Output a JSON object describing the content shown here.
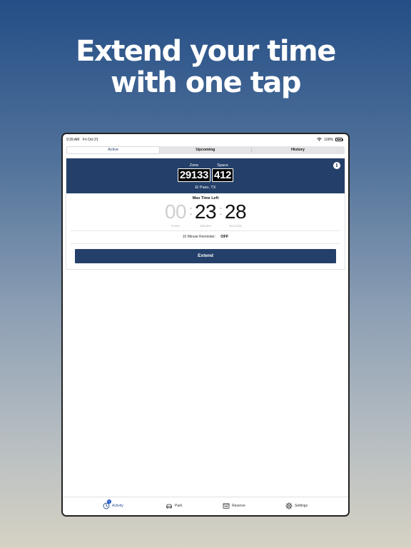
{
  "headline": {
    "line1": "Extend your time",
    "line2": "with one tap"
  },
  "status_bar": {
    "time": "9:39 AM",
    "date": "Fri Oct 21",
    "battery": "100%"
  },
  "segments": [
    {
      "label": "Active",
      "selected": true
    },
    {
      "label": "Upcoming",
      "selected": false
    },
    {
      "label": "History",
      "selected": false
    }
  ],
  "session": {
    "zone_label": "Zone",
    "zone": "29133",
    "space_label": "Space",
    "space": "412",
    "location": "El Paso, TX",
    "info_icon": "i"
  },
  "timer": {
    "title": "Max Time Left",
    "hours": "00",
    "minutes": "23",
    "seconds": "28",
    "hours_label": "Hours",
    "minutes_label": "Minutes",
    "seconds_label": "Seconds"
  },
  "reminder": {
    "label": "10 Minute Reminder:",
    "value": "OFF"
  },
  "extend_button": "Extend",
  "tab_bar": {
    "items": [
      {
        "label": "Activity",
        "icon": "clock-icon",
        "active": true,
        "badge": "1"
      },
      {
        "label": "Park",
        "icon": "car-icon",
        "active": false
      },
      {
        "label": "Reserve",
        "icon": "calendar-icon",
        "active": false
      },
      {
        "label": "Settings",
        "icon": "gear-icon",
        "active": false
      }
    ]
  },
  "colors": {
    "brand_navy": "#24406a",
    "active_tab": "#2a4f8f",
    "badge": "#1d55c8"
  }
}
